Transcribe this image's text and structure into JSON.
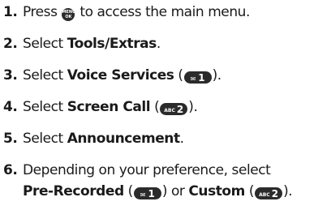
{
  "steps": [
    {
      "number": "1.",
      "pre": "Press ",
      "key_top": "MENU",
      "key_bottom": "OK",
      "post": " to access the main menu."
    },
    {
      "number": "2.",
      "pre": "Select ",
      "bold": "Tools/Extras",
      "post": "."
    },
    {
      "number": "3.",
      "pre": "Select ",
      "bold": "Voice Services",
      "open": " (",
      "key_icon": "✉",
      "key_digit": "1",
      "close": ")."
    },
    {
      "number": "4.",
      "pre": "Select ",
      "bold": "Screen Call",
      "open": " (",
      "key_label": "ABC",
      "key_digit": "2",
      "close": ")."
    },
    {
      "number": "5.",
      "pre": "Select ",
      "bold": "Announcement",
      "post": "."
    },
    {
      "number": "6.",
      "pre": "Depending on your preference, select",
      "bold_a": "Pre-Recorded",
      "open_a": " (",
      "key_a_icon": "✉",
      "key_a_digit": "1",
      "close_a": ") or ",
      "bold_b": "Custom",
      "open_b": " (",
      "key_b_label": "ABC",
      "key_b_digit": "2",
      "close_b": ")."
    }
  ]
}
